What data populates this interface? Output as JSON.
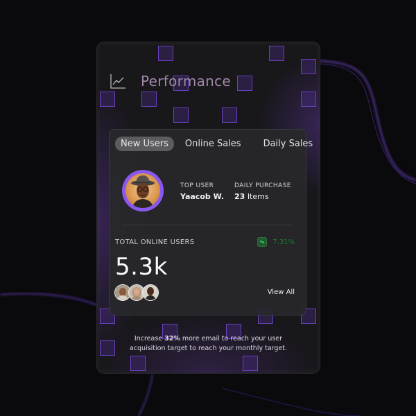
{
  "header": {
    "icon": "line-chart-icon",
    "title": "Performance"
  },
  "tabs": [
    {
      "label": "New Users",
      "active": true
    },
    {
      "label": "Online Sales",
      "active": false
    },
    {
      "label": "Daily Sales",
      "active": false
    }
  ],
  "top_user": {
    "label": "TOP USER",
    "name": "Yaacob W.",
    "avatar_ring_color": "#8a58f0"
  },
  "daily_purchase": {
    "label": "DAILY PURCHASE",
    "count": "23",
    "unit": "Items"
  },
  "online_users": {
    "label": "TOTAL ONLINE USERS",
    "value": "5.3k",
    "trend_icon": "trending-up-icon",
    "trend_value": "7.31%",
    "trend_color": "#1f7a37",
    "view_all_label": "View All",
    "avatars": [
      "user-avatar-1",
      "user-avatar-2",
      "user-avatar-3"
    ]
  },
  "footer": {
    "prefix": "Increase ",
    "highlight": "32%",
    "line1_rest": " more email to reach your user",
    "line2": "acquisition target to reach your monthly target."
  },
  "colors": {
    "accent": "#8a58f0",
    "square_border": "#6a40c0",
    "background": "#0a090b"
  }
}
